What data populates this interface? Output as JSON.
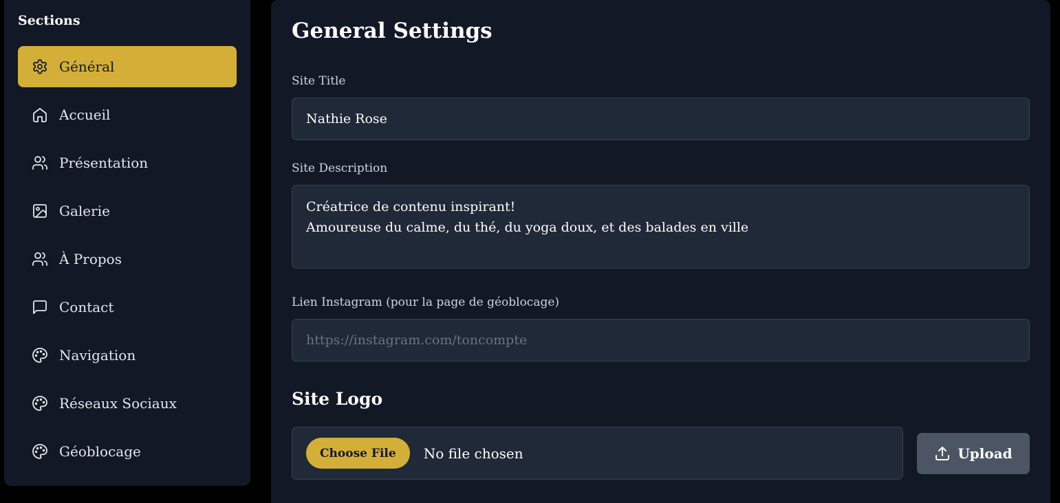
{
  "sidebar": {
    "heading": "Sections",
    "items": [
      {
        "label": "Général",
        "icon": "gear-icon",
        "active": true
      },
      {
        "label": "Accueil",
        "icon": "home-icon"
      },
      {
        "label": "Présentation",
        "icon": "users-icon"
      },
      {
        "label": "Galerie",
        "icon": "image-icon"
      },
      {
        "label": "À Propos",
        "icon": "users-icon"
      },
      {
        "label": "Contact",
        "icon": "message-square-icon"
      },
      {
        "label": "Navigation",
        "icon": "palette-icon"
      },
      {
        "label": "Réseaux Sociaux",
        "icon": "palette-icon"
      },
      {
        "label": "Géoblocage",
        "icon": "palette-icon"
      }
    ]
  },
  "main": {
    "title": "General Settings",
    "site_title": {
      "label": "Site Title",
      "value": "Nathie Rose"
    },
    "site_description": {
      "label": "Site Description",
      "value": "Créatrice de contenu inspirant!\nAmoureuse du calme, du thé, du yoga doux, et des balades en ville"
    },
    "instagram": {
      "label": "Lien Instagram (pour la page de géoblocage)",
      "value": "",
      "placeholder": "https://instagram.com/toncompte"
    },
    "logo": {
      "title": "Site Logo",
      "choose_label": "Choose File",
      "status": "No file chosen",
      "upload_label": "Upload"
    }
  },
  "colors": {
    "accent": "#d4af37",
    "panel": "#121826",
    "field": "#1f2937",
    "upload_button": "#4b5563"
  }
}
